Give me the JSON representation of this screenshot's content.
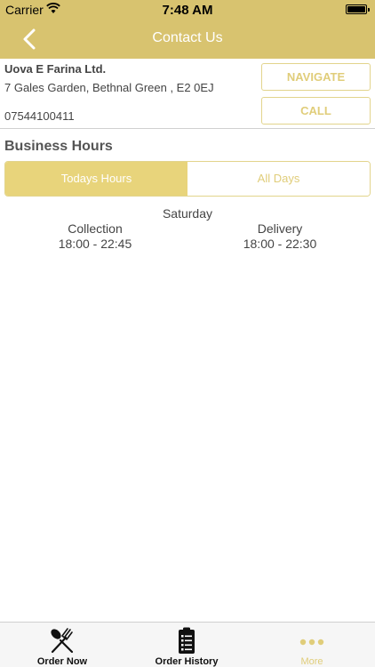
{
  "status_bar": {
    "carrier": "Carrier",
    "time": "7:48 AM"
  },
  "nav": {
    "title": "Contact Us",
    "back_icon": "chevron-left-icon"
  },
  "business": {
    "name": "Uova E Farina Ltd.",
    "address": "7 Gales Garden, Bethnal Green , E2 0EJ",
    "phone": "07544100411"
  },
  "actions": {
    "navigate_label": "NAVIGATE",
    "call_label": "CALL"
  },
  "hours": {
    "section_title": "Business Hours",
    "tabs": [
      {
        "label": "Todays Hours",
        "selected": true
      },
      {
        "label": "All Days",
        "selected": false
      }
    ],
    "day": "Saturday",
    "collection": {
      "label": "Collection",
      "time": "18:00 - 22:45"
    },
    "delivery": {
      "label": "Delivery",
      "time": "18:00 - 22:30"
    }
  },
  "tab_bar": {
    "items": [
      {
        "label": "Order Now",
        "icon": "fork-spoon-icon"
      },
      {
        "label": "Order History",
        "icon": "clipboard-list-icon"
      },
      {
        "label": "More",
        "icon": "more-dots-icon",
        "selected": true
      }
    ]
  },
  "colors": {
    "accent": "#d8c36f",
    "accent_light": "#e0cd7a"
  }
}
